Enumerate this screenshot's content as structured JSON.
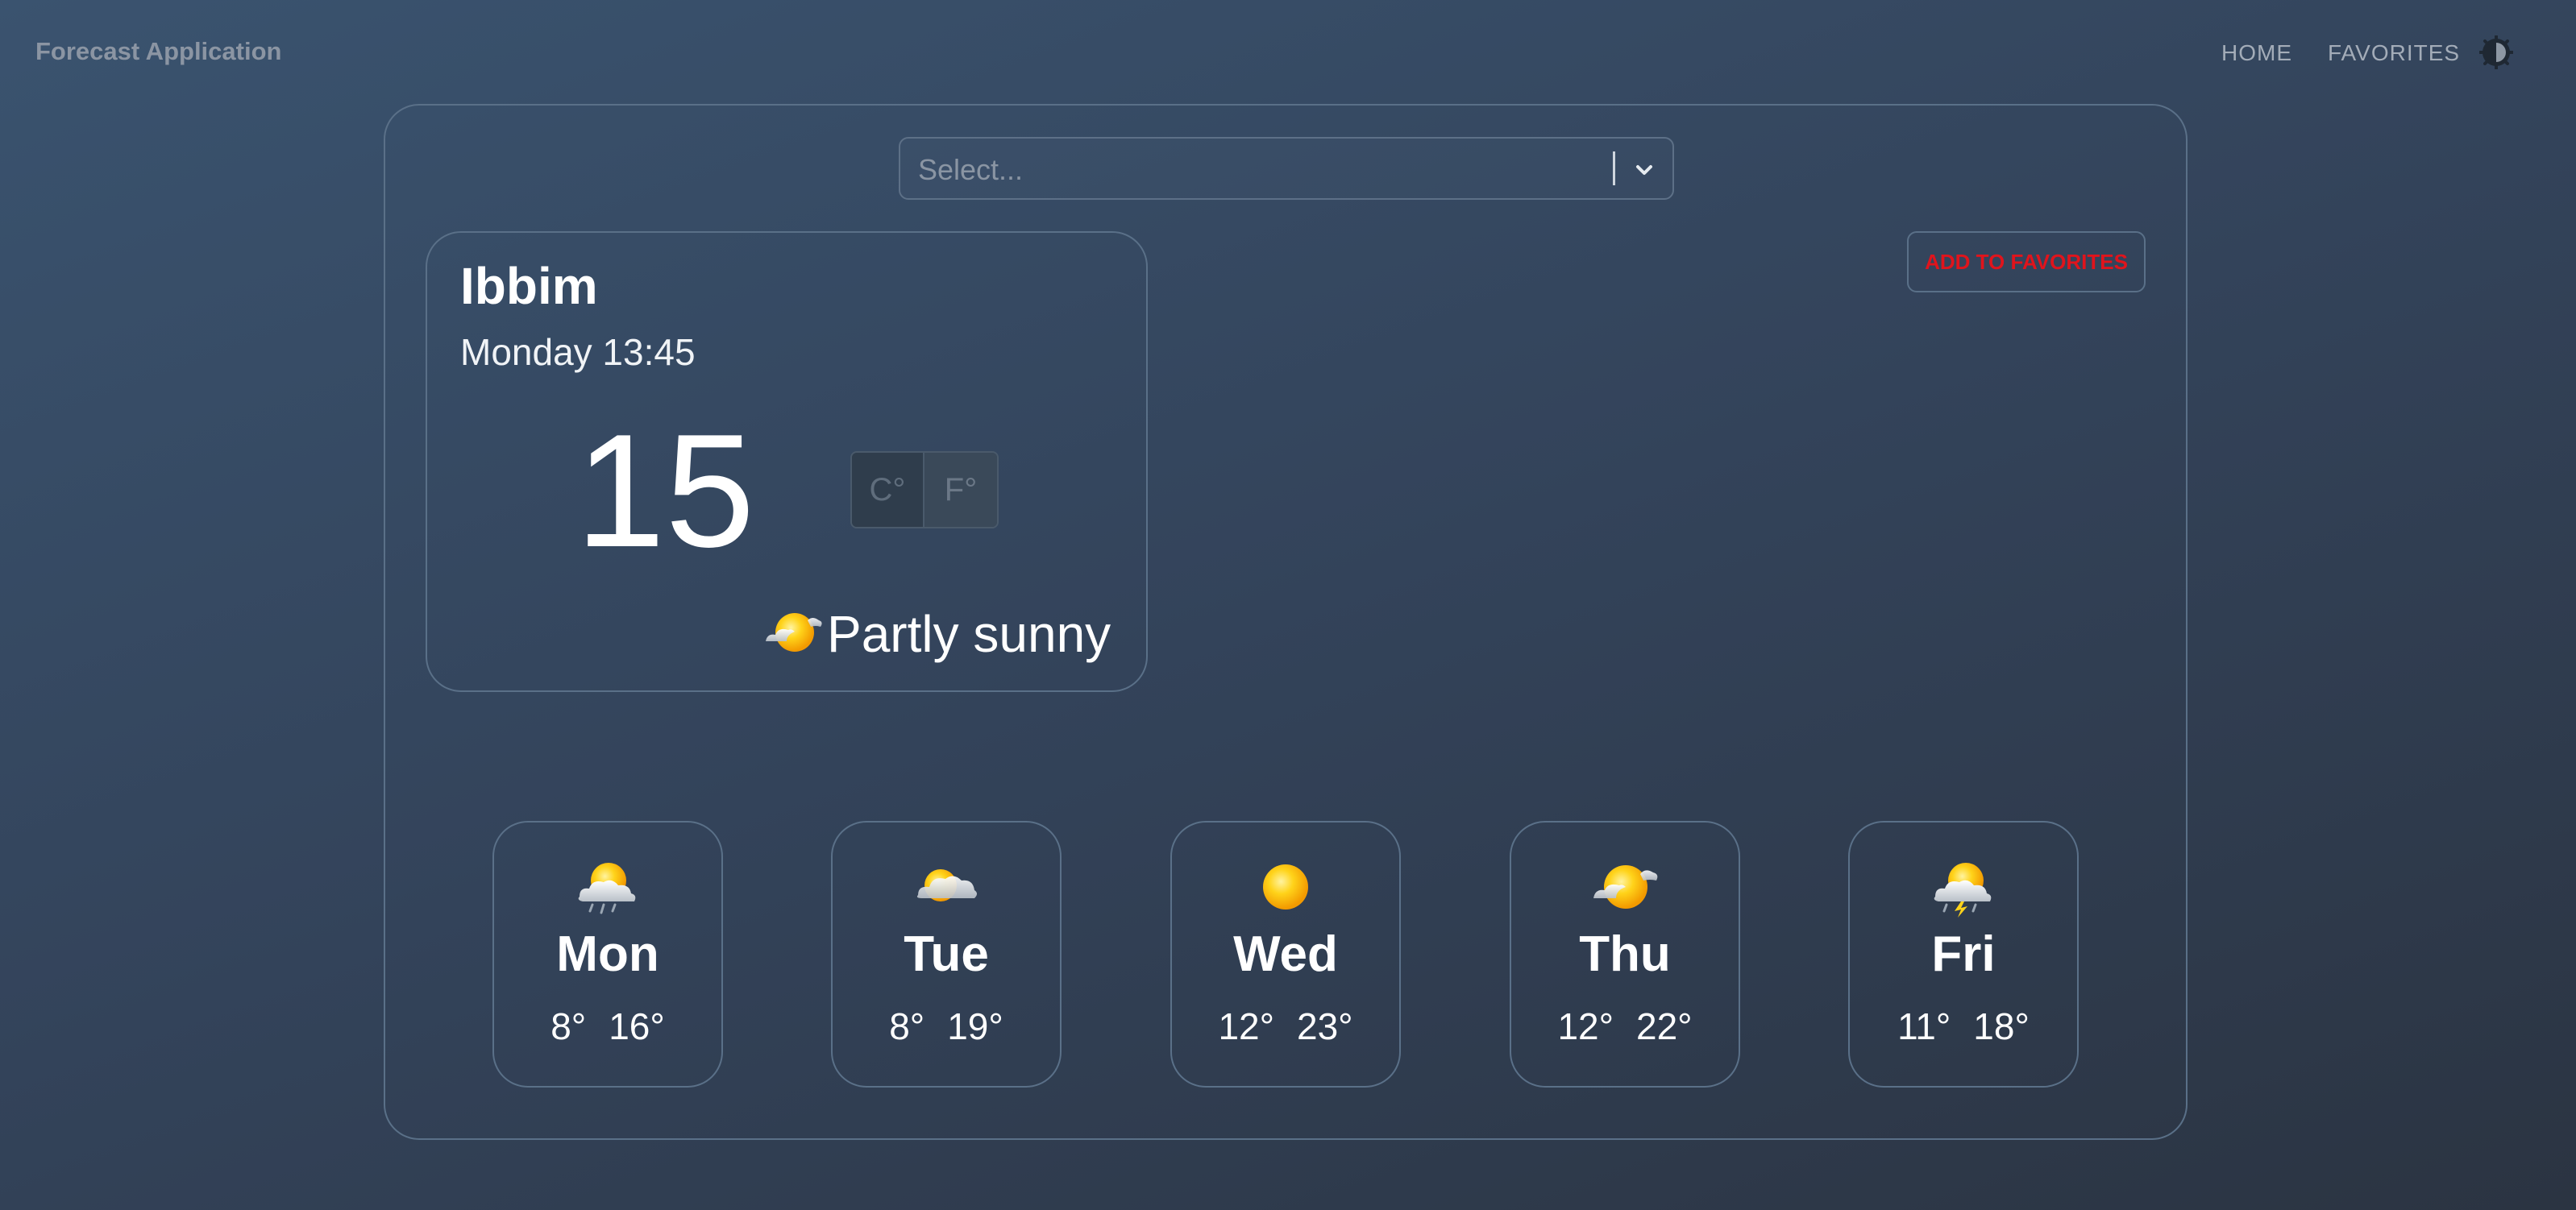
{
  "app": {
    "title": "Forecast Application"
  },
  "nav": {
    "home": "HOME",
    "favorites": "FAVORITES",
    "theme_icon": "half-circle-contrast-icon"
  },
  "search": {
    "placeholder": "Select..."
  },
  "current": {
    "city": "Ibbim",
    "datetime": "Monday 13:45",
    "temperature": "15",
    "unit_celsius": "C°",
    "unit_fahrenheit": "F°",
    "selected_unit": "C°",
    "condition": "Partly sunny",
    "condition_icon": "partly-sunny-icon"
  },
  "actions": {
    "add_favorites": "ADD TO FAVORITES",
    "add_favorites_color": "#e0141c"
  },
  "forecast": [
    {
      "day": "Mon",
      "low": "8°",
      "high": "16°",
      "icon": "sun-cloud-rain-icon"
    },
    {
      "day": "Tue",
      "low": "8°",
      "high": "19°",
      "icon": "sun-cloud-icon"
    },
    {
      "day": "Wed",
      "low": "12°",
      "high": "23°",
      "icon": "sun-icon"
    },
    {
      "day": "Thu",
      "low": "12°",
      "high": "22°",
      "icon": "partly-sunny-icon"
    },
    {
      "day": "Fri",
      "low": "11°",
      "high": "18°",
      "icon": "sun-cloud-storm-icon"
    }
  ]
}
